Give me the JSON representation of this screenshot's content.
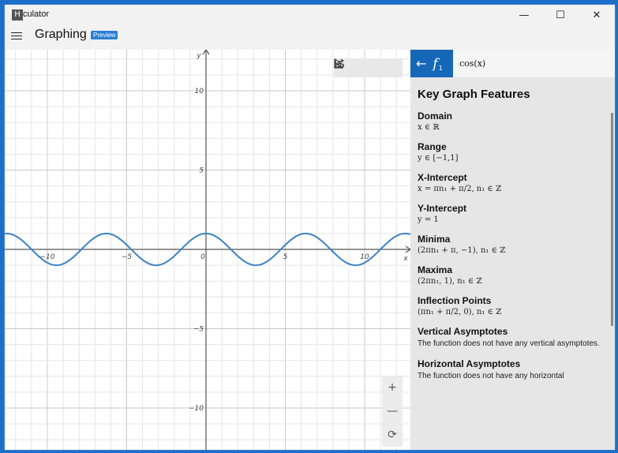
{
  "window": {
    "app_icon_letter": "H",
    "title": "culator",
    "minimize_glyph": "—",
    "maximize_glyph": "☐",
    "close_glyph": "✕"
  },
  "header": {
    "mode_title": "Graphing",
    "preview_badge": "Preview"
  },
  "graph": {
    "y_axis_label": "y",
    "x_axis_label": "x",
    "x_tick_labels": [
      "−10",
      "−5",
      "0",
      "5",
      "10"
    ],
    "y_tick_labels": [
      "10",
      "5",
      "−5",
      "−10"
    ],
    "curve_color": "#3b82c4",
    "toolbar": [
      "select-cursor-icon",
      "share-icon",
      "graph-options-icon"
    ],
    "zoom_in_glyph": "+",
    "zoom_out_glyph": "—",
    "reset_view_glyph": "⟳"
  },
  "chart_data": {
    "type": "line",
    "function": "cos(x)",
    "xlim": [
      -13,
      13
    ],
    "ylim": [
      -12.5,
      12.5
    ],
    "grid": true,
    "series": [
      {
        "name": "",
        "function": "cos(x)",
        "color": "#3b82c4"
      }
    ]
  },
  "panel": {
    "back_arrow": "←",
    "function_label": "f",
    "function_subscript": "1",
    "function_expression": "cos(x)",
    "heading": "Key Graph Features",
    "features": [
      {
        "name": "Domain",
        "value": "x ∈ ℝ"
      },
      {
        "name": "Range",
        "value": "y ∈ [−1,1]"
      },
      {
        "name": "X-Intercept",
        "value": "x = πn₁ + π/2, n₁ ∈ ℤ"
      },
      {
        "name": "Y-Intercept",
        "value": "y = 1"
      },
      {
        "name": "Minima",
        "value": "(2πn₁ + π, −1), n₁ ∈ ℤ"
      },
      {
        "name": "Maxima",
        "value": "(2πn₁, 1), n₁ ∈ ℤ"
      },
      {
        "name": "Inflection Points",
        "value": "(πn₁ + π/2, 0), n₁ ∈ ℤ"
      },
      {
        "name": "Vertical Asymptotes",
        "value": "The function does not have any vertical asymptotes."
      },
      {
        "name": "Horizontal Asymptotes",
        "value": "The function does not have any horizontal"
      }
    ]
  }
}
